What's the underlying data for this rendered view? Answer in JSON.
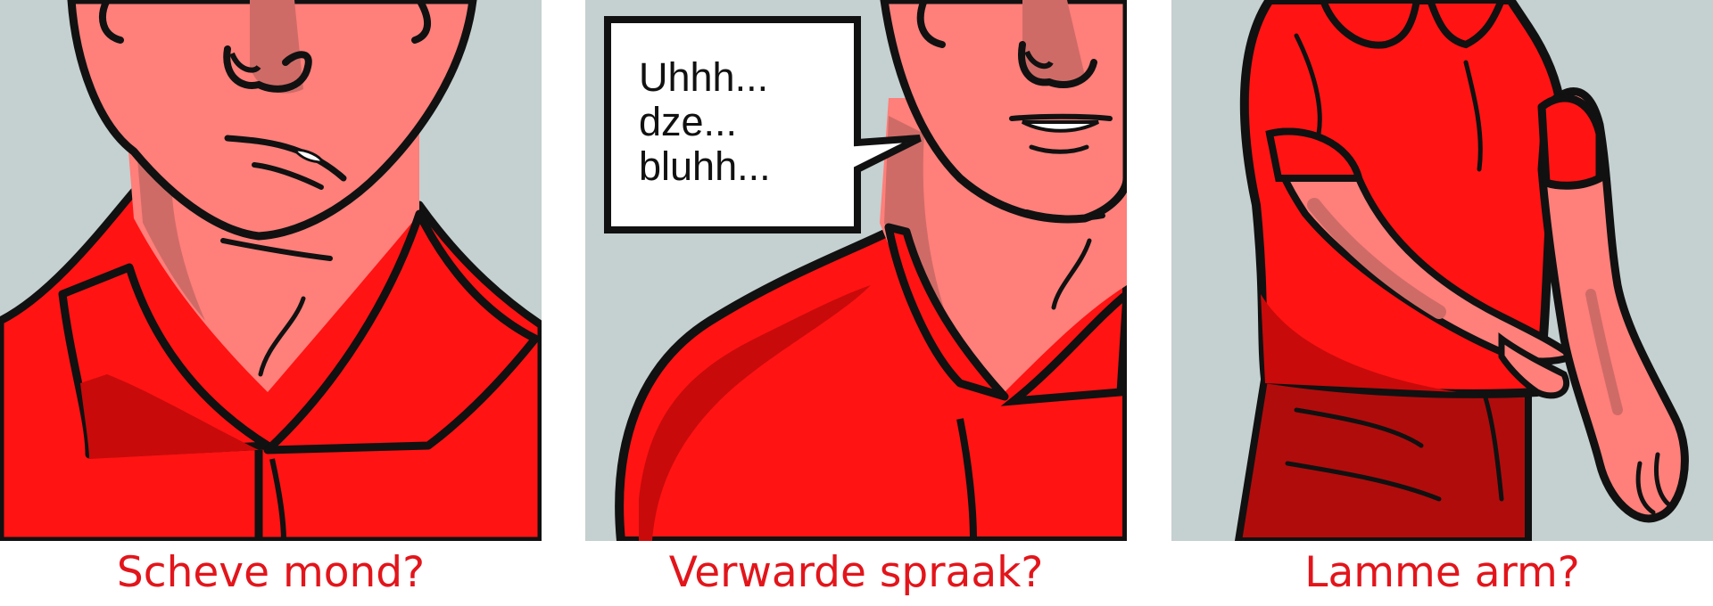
{
  "panels": [
    {
      "caption": "Scheve mond?"
    },
    {
      "caption": "Verwarde spraak?",
      "speech_bubble": {
        "lines": [
          "Uhhh...",
          "dze...",
          "bluhh..."
        ]
      }
    },
    {
      "caption": "Lamme arm?"
    }
  ],
  "colors": {
    "background": "#c5d0d0",
    "skin": "#ff7f7a",
    "skin_shadow": "#cf6b67",
    "shirt": "#ff1313",
    "shirt_shadow": "#c80a0a",
    "pants": "#b00c0c",
    "outline": "#111111",
    "caption": "#e2151b"
  }
}
